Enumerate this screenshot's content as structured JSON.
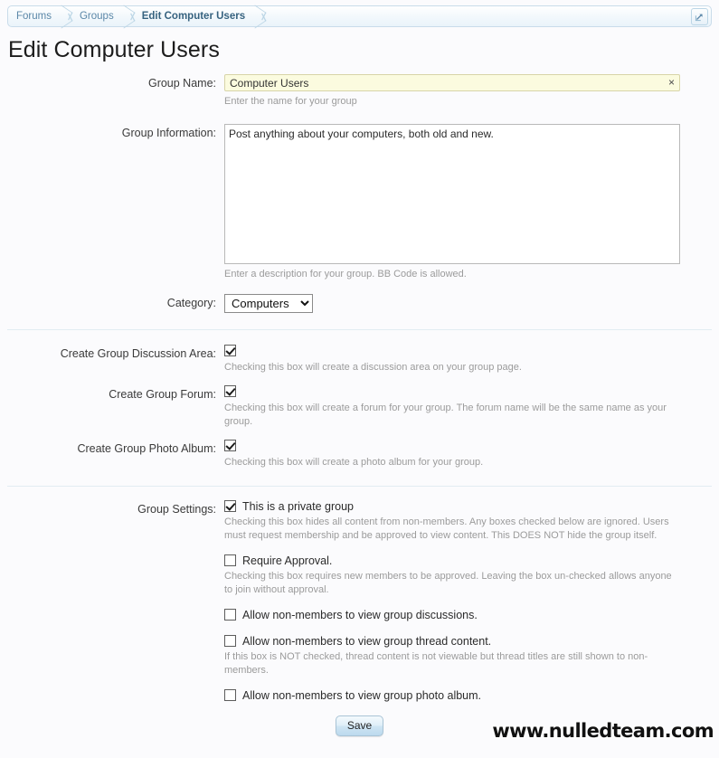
{
  "breadcrumb": {
    "items": [
      {
        "label": "Forums",
        "current": false
      },
      {
        "label": "Groups",
        "current": false
      },
      {
        "label": "Edit Computer Users",
        "current": true
      }
    ],
    "popup_icon": "external-link-icon"
  },
  "page_title": "Edit Computer Users",
  "form": {
    "group_name": {
      "label": "Group Name:",
      "value": "Computer Users",
      "placeholder": "",
      "hint": "Enter the name for your group",
      "clear_glyph": "×",
      "background_color": "#fbfbdf"
    },
    "group_information": {
      "label": "Group Information:",
      "value": "Post anything about your computers, both old and new.",
      "placeholder": "",
      "hint": "Enter a description for your group. BB Code is allowed."
    },
    "category": {
      "label": "Category:",
      "selected": "Computers",
      "options": [
        "Computers"
      ]
    },
    "create_discussion_area": {
      "label": "Create Group Discussion Area:",
      "checked": true,
      "hint": "Checking this box will create a discussion area on your group page."
    },
    "create_forum": {
      "label": "Create Group Forum:",
      "checked": true,
      "hint": "Checking this box will create a forum for your group. The forum name will be the same name as your group."
    },
    "create_photo_album": {
      "label": "Create Group Photo Album:",
      "checked": true,
      "hint": "Checking this box will create a photo album for your group."
    },
    "group_settings": {
      "label": "Group Settings:",
      "options": [
        {
          "text": "This is a private group",
          "checked": true,
          "hint": "Checking this box hides all content from non-members. Any boxes checked below are ignored. Users must request membership and be approved to view content. This DOES NOT hide the group itself."
        },
        {
          "text": "Require Approval.",
          "checked": false,
          "hint": "Checking this box requires new members to be approved. Leaving the box un-checked allows anyone to join without approval."
        },
        {
          "text": "Allow non-members to view group discussions.",
          "checked": false,
          "hint": ""
        },
        {
          "text": "Allow non-members to view group thread content.",
          "checked": false,
          "hint": "If this box is NOT checked, thread content is not viewable but thread titles are still shown to non-members."
        },
        {
          "text": "Allow non-members to view group photo album.",
          "checked": false,
          "hint": ""
        }
      ]
    },
    "save_label": "Save"
  },
  "watermark": "www.nulledteam.com"
}
